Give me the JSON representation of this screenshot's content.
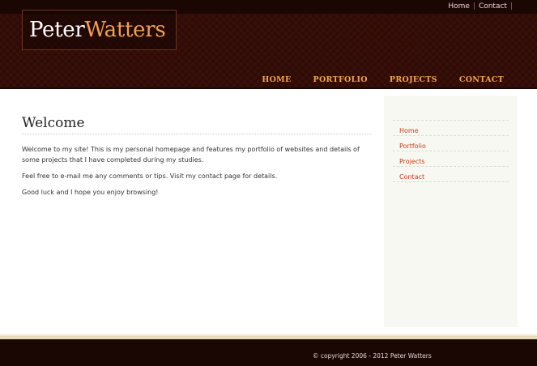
{
  "top_links": {
    "home": "Home",
    "separator": "|",
    "contact": "Contact",
    "trail": "|"
  },
  "logo": {
    "first": "Peter",
    "last": "Watters"
  },
  "nav": [
    "HOME",
    "PORTFOLIO",
    "PROJECTS",
    "CONTACT"
  ],
  "main": {
    "title": "Welcome",
    "paragraphs": [
      "Welcome to my site! This is my personal homepage and features my portfolio of websites and details of some projects that I have completed during my studies.",
      "Feel free to e-mail me any comments or tips. Visit my contact page for details.",
      "Good luck and I hope you enjoy browsing!"
    ]
  },
  "sidebar": [
    "Home",
    "Portfolio",
    "Projects",
    "Contact"
  ],
  "footer": {
    "copyright": "© copyright 2006 - 2012 Peter Watters"
  },
  "colors": {
    "header_bg": "#3a0f08",
    "accent": "#f2a550",
    "link": "#c0401a",
    "footer_bg": "#1a0603"
  }
}
